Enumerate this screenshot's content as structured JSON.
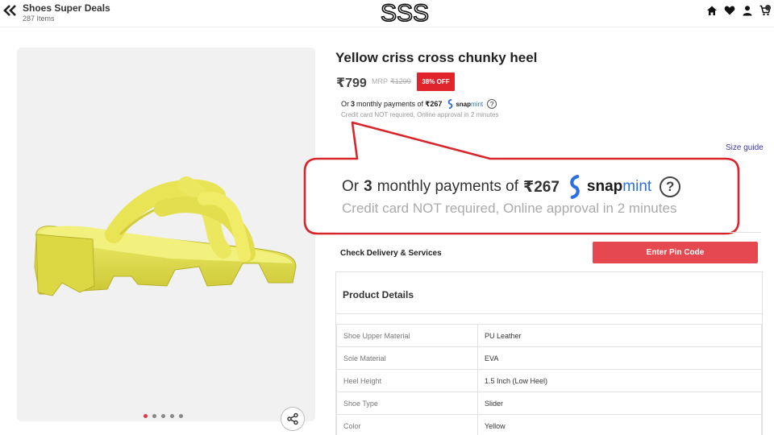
{
  "header": {
    "store_title": "Shoes Super Deals",
    "store_count": "287 Items",
    "logo_text": "SSS",
    "icons": [
      "back-icon",
      "home-icon",
      "heart-icon",
      "user-icon",
      "cart-icon"
    ]
  },
  "gallery": {
    "dot_count": 5,
    "active_dot": 0,
    "share_icon": "share-icon"
  },
  "product": {
    "title": "Yellow criss cross chunky heel",
    "price": "₹799",
    "mrp_label": "MRP",
    "mrp_value": "₹1299",
    "discount": "38% OFF"
  },
  "emi": {
    "prefix": "Or",
    "count": "3",
    "middle": "monthly payments of",
    "amount": "₹267",
    "brand_a": "snap",
    "brand_b": "mint",
    "help": "?",
    "note": "Credit card NOT required, Online approval in 2 minutes"
  },
  "size_guide": "Size guide",
  "delivery": {
    "label": "Check Delivery & Services",
    "button": "Enter Pin Code"
  },
  "details": {
    "title": "Product Details",
    "rows": [
      {
        "k": "Shoe Upper Material",
        "v": "PU Leather"
      },
      {
        "k": "Sole Material",
        "v": "EVA"
      },
      {
        "k": "Heel Height",
        "v": "1.5 Inch (Low Heel)"
      },
      {
        "k": "Shoe Type",
        "v": "Slider"
      },
      {
        "k": "Color",
        "v": "Yellow"
      }
    ]
  },
  "colors": {
    "accent": "#e5484f",
    "discount_badge": "#e0242c",
    "callout_border": "#d8252b",
    "snapmint_blue": "#2f6fe0",
    "link": "#3a3aa8",
    "product": "#e6e355"
  }
}
